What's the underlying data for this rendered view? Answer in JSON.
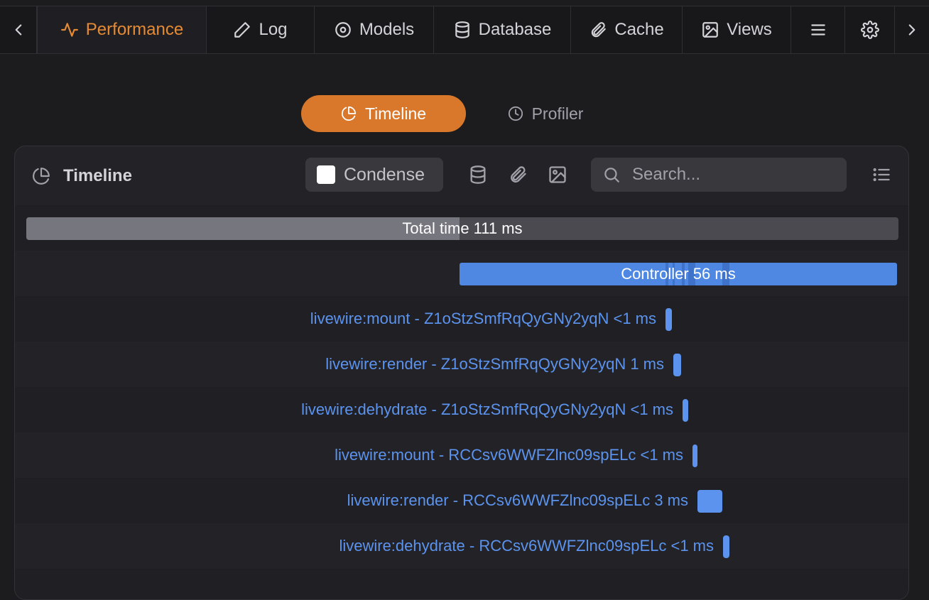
{
  "nav": {
    "back_icon": "chevron-left-icon",
    "forward_icon": "chevron-right-icon",
    "tabs": [
      {
        "label": "Performance",
        "icon": "activity-icon",
        "active": true
      },
      {
        "label": "Log",
        "icon": "pencil-icon"
      },
      {
        "label": "Models",
        "icon": "circle-dot-icon"
      },
      {
        "label": "Database",
        "icon": "database-icon"
      },
      {
        "label": "Cache",
        "icon": "paperclip-icon"
      },
      {
        "label": "Views",
        "icon": "image-icon"
      }
    ],
    "menu_icon": "menu-icon",
    "settings_icon": "gear-icon"
  },
  "subtabs": [
    {
      "label": "Timeline",
      "icon": "pie-chart-icon",
      "active": true
    },
    {
      "label": "Profiler",
      "icon": "clock-icon"
    }
  ],
  "panel": {
    "title": "Timeline",
    "condense_label": "Condense",
    "condense_checked": false,
    "search_placeholder": "Search...",
    "total": {
      "label": "Total time 111 ms",
      "fraction_highlighted": 0.497
    },
    "controller": {
      "label": "Controller 56 ms"
    },
    "events": [
      {
        "label": "livewire:mount - Z1oStzSmfRqQyGNy2yqN <1 ms"
      },
      {
        "label": "livewire:render - Z1oStzSmfRqQyGNy2yqN 1 ms"
      },
      {
        "label": "livewire:dehydrate - Z1oStzSmfRqQyGNy2yqN <1 ms"
      },
      {
        "label": "livewire:mount - RCCsv6WWFZlnc09spELc <1 ms"
      },
      {
        "label": "livewire:render - RCCsv6WWFZlnc09spELc 3 ms"
      },
      {
        "label": "livewire:dehydrate - RCCsv6WWFZlnc09spELc <1 ms"
      }
    ]
  },
  "colors": {
    "accent": "#d9782b",
    "event_blue": "#5b93ee",
    "controller_blue": "#4f88e3"
  }
}
